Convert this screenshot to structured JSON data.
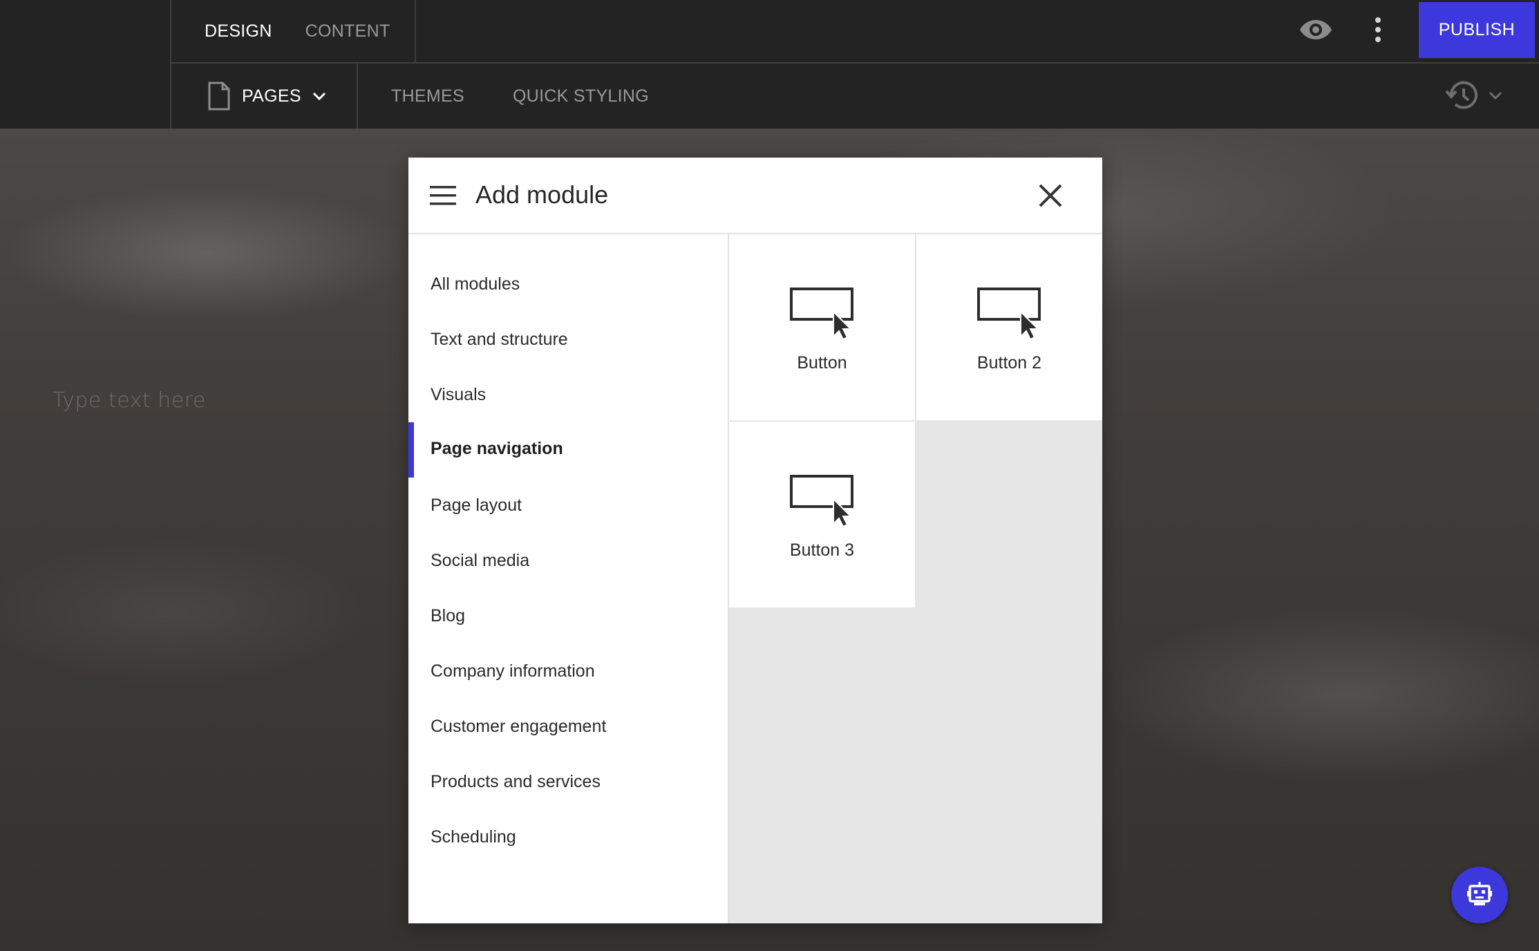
{
  "topbar": {
    "tabs": [
      {
        "label": "DESIGN",
        "active": true
      },
      {
        "label": "CONTENT",
        "active": false
      }
    ],
    "preview_icon": "eye-icon",
    "more_icon": "more-vertical-icon",
    "publish_label": "PUBLISH"
  },
  "secondbar": {
    "pages_icon": "page-icon",
    "pages_label": "PAGES",
    "pages_chevron": "chevron-down-icon",
    "tabs": [
      {
        "label": "THEMES"
      },
      {
        "label": "QUICK STYLING"
      }
    ],
    "history_icon": "history-icon"
  },
  "canvas": {
    "placeholder_text": "Type text here"
  },
  "modal": {
    "title": "Add module",
    "menu_icon": "hamburger-icon",
    "close_icon": "close-icon",
    "categories": [
      {
        "label": "All modules",
        "active": false
      },
      {
        "label": "Text and structure",
        "active": false
      },
      {
        "label": "Visuals",
        "active": false
      },
      {
        "label": "Page navigation",
        "active": true
      },
      {
        "label": "Page layout",
        "active": false
      },
      {
        "label": "Social media",
        "active": false
      },
      {
        "label": "Blog",
        "active": false
      },
      {
        "label": "Company information",
        "active": false
      },
      {
        "label": "Customer engagement",
        "active": false
      },
      {
        "label": "Products and services",
        "active": false
      },
      {
        "label": "Scheduling",
        "active": false
      }
    ],
    "modules": [
      {
        "label": "Button",
        "icon": "button-cursor-icon"
      },
      {
        "label": "Button 2",
        "icon": "button-cursor-icon"
      },
      {
        "label": "Button 3",
        "icon": "button-cursor-icon"
      }
    ]
  },
  "help_bot": {
    "icon": "robot-icon"
  },
  "colors": {
    "accent": "#3c38dc",
    "topbar_bg": "#232323",
    "modal_bg": "#ffffff",
    "module_area_bg": "#e6e6e6"
  }
}
